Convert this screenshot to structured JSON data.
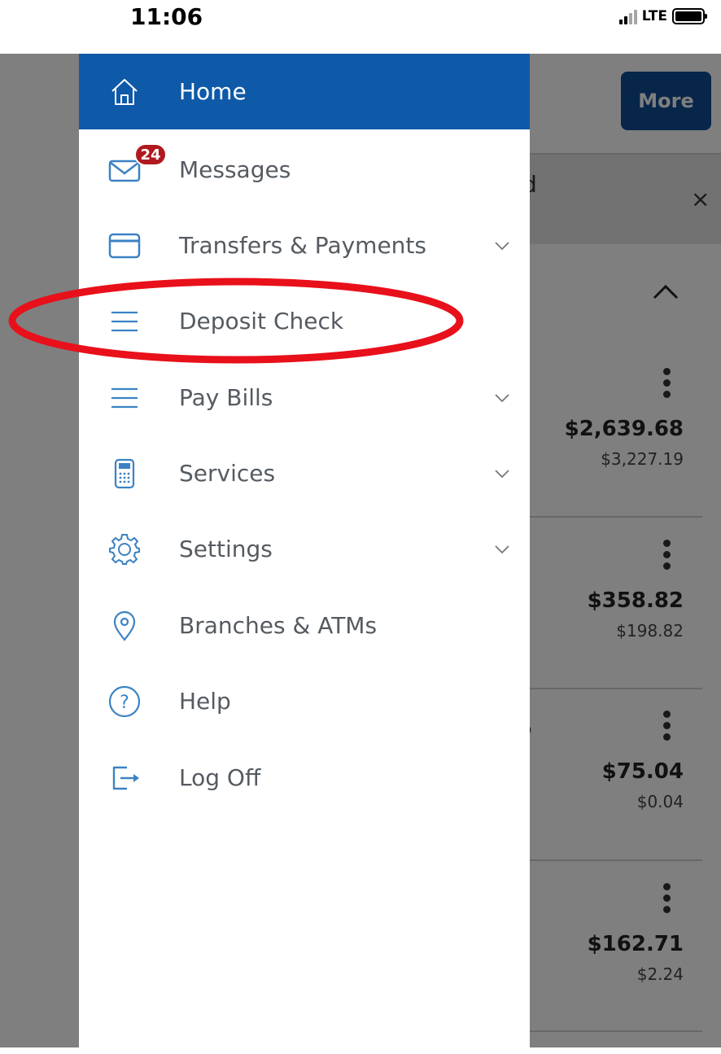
{
  "status_bar": {
    "time": "11:06",
    "network": "LTE",
    "icons": [
      "signal-icon",
      "battery-icon"
    ]
  },
  "drawer": {
    "accent_color": "#0e59a8",
    "items": [
      {
        "label": "Home",
        "icon": "home-icon",
        "active": true,
        "expandable": false
      },
      {
        "label": "Messages",
        "icon": "envelope-icon",
        "badge": "24",
        "active": false,
        "expandable": false
      },
      {
        "label": "Transfers & Payments",
        "icon": "credit-card-icon",
        "active": false,
        "expandable": true
      },
      {
        "label": "Deposit Check",
        "icon": "menu-lines-icon",
        "active": false,
        "expandable": false,
        "highlighted": true
      },
      {
        "label": "Pay Bills",
        "icon": "menu-lines-icon",
        "active": false,
        "expandable": true
      },
      {
        "label": "Services",
        "icon": "calculator-icon",
        "active": false,
        "expandable": true
      },
      {
        "label": "Settings",
        "icon": "gear-icon",
        "active": false,
        "expandable": true
      },
      {
        "label": "Branches & ATMs",
        "icon": "map-pin-icon",
        "active": false,
        "expandable": false
      },
      {
        "label": "Help",
        "icon": "help-circle-icon",
        "active": false,
        "expandable": false
      },
      {
        "label": "Log Off",
        "icon": "log-off-icon",
        "active": false,
        "expandable": false
      }
    ]
  },
  "background": {
    "more_label": "More",
    "notice_fragment": "d",
    "notice_close": "×",
    "row_fragment": "5",
    "accounts": [
      {
        "amount": "$2,639.68",
        "sub_amount": "$3,227.19"
      },
      {
        "amount": "$358.82",
        "sub_amount": "$198.82"
      },
      {
        "amount": "$75.04",
        "sub_amount": "$0.04"
      },
      {
        "amount": "$162.71",
        "sub_amount": "$2.24"
      }
    ]
  },
  "annotation": {
    "color": "#e8101a",
    "target": "Deposit Check"
  }
}
